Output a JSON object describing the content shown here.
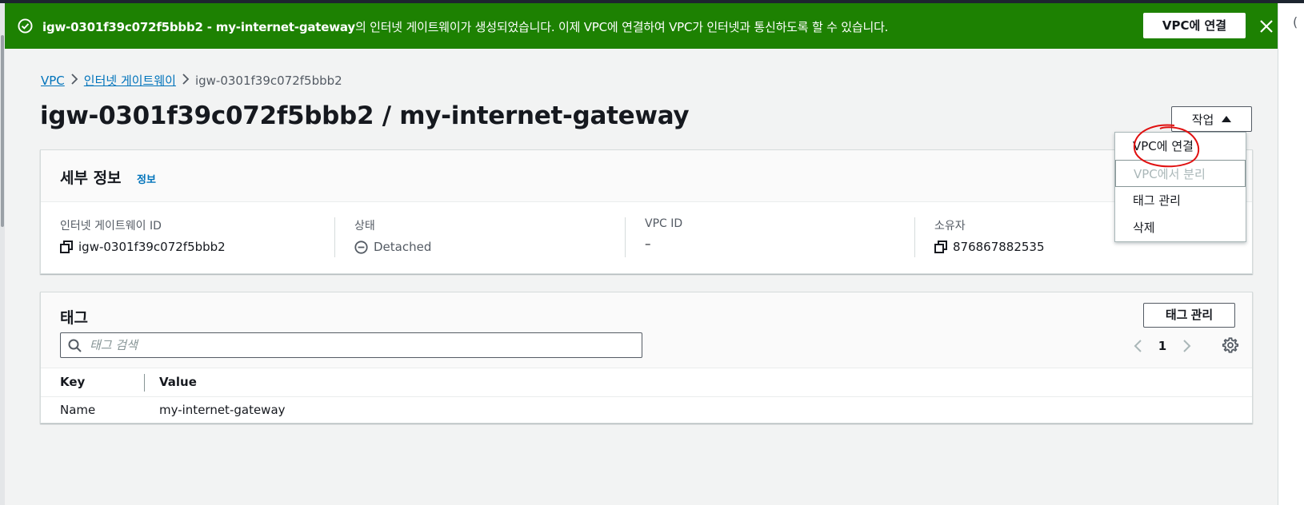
{
  "flash": {
    "resource": "igw-0301f39c072f5bbb2 - my-internet-gateway",
    "message_rest": "의 인터넷 게이트웨이가 생성되었습니다. 이제 VPC에 연결하여 VPC가 인터넷과 통신하도록 할 수 있습니다.",
    "action_label": "VPC에 연결",
    "color": "#1d8102"
  },
  "breadcrumb": {
    "items": [
      "VPC",
      "인터넷 게이트웨이"
    ],
    "current": "igw-0301f39c072f5bbb2"
  },
  "page": {
    "title": "igw-0301f39c072f5bbb2 / my-internet-gateway",
    "actions_label": "작업"
  },
  "actions_menu": {
    "items": [
      "VPC에 연결",
      "VPC에서 분리",
      "태그 관리",
      "삭제"
    ],
    "disabled_item": "VPC에서 분리"
  },
  "details": {
    "title": "세부 정보",
    "info_link": "정보",
    "fields": [
      {
        "label": "인터넷 게이트웨이 ID",
        "value": "igw-0301f39c072f5bbb2",
        "icon": "copy-icon"
      },
      {
        "label": "상태",
        "value": "Detached",
        "icon": "detached-status-icon"
      },
      {
        "label": "VPC ID",
        "value": "–"
      },
      {
        "label": "소유자",
        "value": "876867882535",
        "icon": "copy-icon"
      }
    ]
  },
  "tags": {
    "title": "태그",
    "manage_label": "태그 관리",
    "search_placeholder": "태그 검색",
    "page": "1",
    "columns": [
      "Key",
      "Value"
    ],
    "rows": [
      {
        "key": "Name",
        "value": "my-internet-gateway"
      }
    ]
  }
}
